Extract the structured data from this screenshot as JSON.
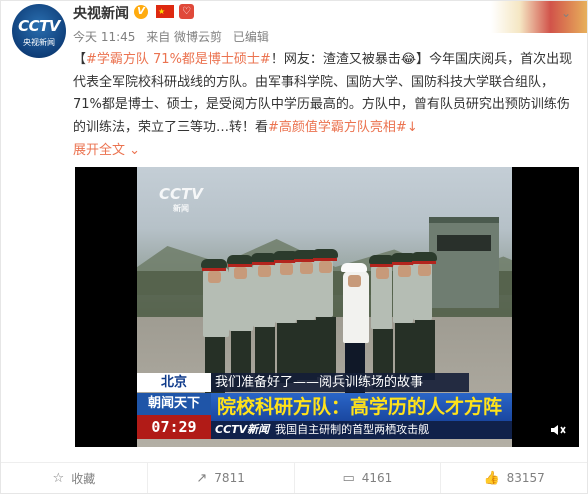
{
  "post": {
    "author": "央视新闻",
    "avatar": {
      "logo": "CCTV",
      "sub": "央视新闻"
    },
    "verified_badge": "V",
    "flag_badge": "★",
    "heart_badge": "♡",
    "meta": {
      "time": "今天 11:45",
      "source": "来自 微博云剪",
      "edited": "已编辑"
    },
    "text": {
      "open_bracket": "【",
      "topic": "#学霸方队 71%都是博士硕士#",
      "headline_rest": "！网友：渣渣又被暴击",
      "emoji": "😂",
      "close_bracket": "】",
      "body": "今年国庆阅兵，首次出现代表全军院校科研战线的方队。由军事科学院、国防大学、国防科技大学联合组队，71%都是博士、硕士，是受阅方队中学历最高的。方队中，曾有队员研究出预防训练伤的训练法，荣立了三等功…转！看",
      "topic2": "#高颜值学霸方队亮相#",
      "tail": "↓"
    },
    "expand_label": "展开全文",
    "expand_icon": "⌄"
  },
  "video": {
    "watermark": "CCTV",
    "watermark_sub": "新闻",
    "location": "北京",
    "strip_text": "我们准备好了——阅兵训练场的故事",
    "program": "朝闻天下",
    "headline": "院校科研方队：高学历的人才方阵",
    "time": "07:29",
    "ticker_logo": "CCTV新闻",
    "ticker_text": "我国自主研制的首型两栖攻击舰",
    "mute_icon": "mute-icon"
  },
  "actions": [
    {
      "name": "collect",
      "icon": "☆",
      "label": "收藏"
    },
    {
      "name": "share",
      "icon": "↗",
      "label": "7811"
    },
    {
      "name": "comment",
      "icon": "▭",
      "label": "4161"
    },
    {
      "name": "like",
      "icon": "👍",
      "label": "83157"
    }
  ],
  "colors": {
    "link": "#eb7350",
    "topic_blue": "#507daf",
    "meta_gray": "#808080"
  }
}
